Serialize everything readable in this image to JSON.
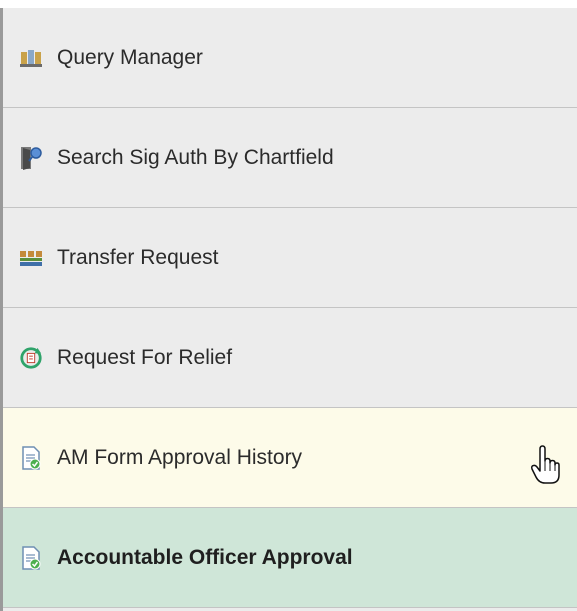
{
  "menu": {
    "items": [
      {
        "label": "Query Manager",
        "icon": "query-manager-icon"
      },
      {
        "label": "Search Sig Auth By Chartfield",
        "icon": "search-door-icon"
      },
      {
        "label": "Transfer Request",
        "icon": "transfer-boxes-icon"
      },
      {
        "label": "Request For Relief",
        "icon": "refresh-document-icon"
      },
      {
        "label": "AM Form Approval History",
        "icon": "approval-document-icon",
        "state": "hover"
      },
      {
        "label": "Accountable Officer Approval",
        "icon": "approval-document-icon",
        "state": "selected"
      }
    ]
  },
  "colors": {
    "menu_bg": "#ececec",
    "hover_bg": "#fdfbe9",
    "selected_bg": "#cfe6d8",
    "divider": "#c4c4c4"
  },
  "cursor": {
    "icon": "hand-pointer-icon"
  }
}
